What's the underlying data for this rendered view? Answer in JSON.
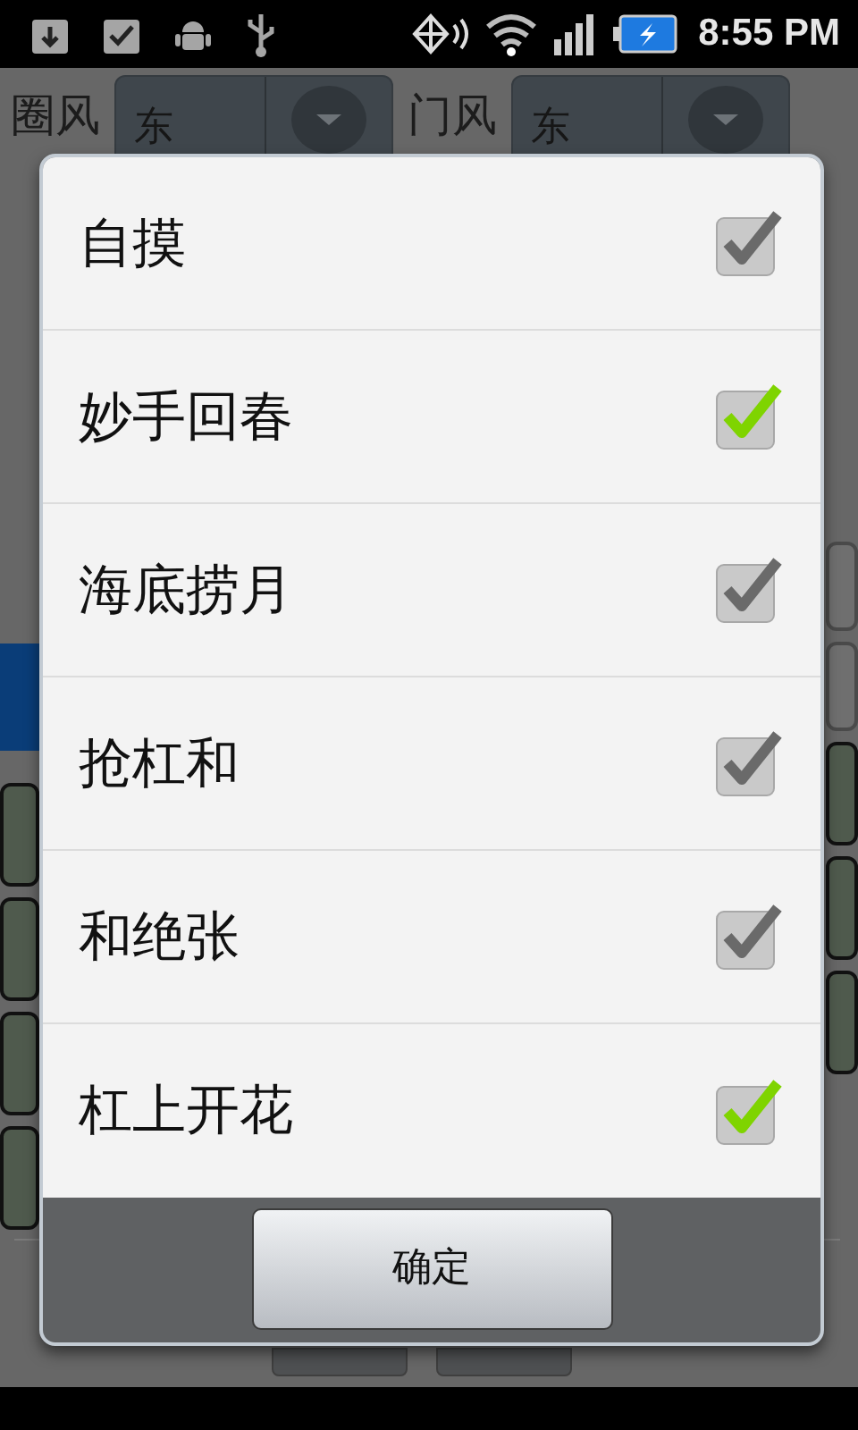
{
  "status_bar": {
    "time": "8:55 PM"
  },
  "background": {
    "fields": [
      {
        "label": "圈风",
        "value": "东"
      },
      {
        "label": "门风",
        "value": "东"
      }
    ]
  },
  "dialog": {
    "items": [
      {
        "label": "自摸",
        "checked": false
      },
      {
        "label": "妙手回春",
        "checked": true
      },
      {
        "label": "海底捞月",
        "checked": false
      },
      {
        "label": "抢杠和",
        "checked": false
      },
      {
        "label": "和绝张",
        "checked": false
      },
      {
        "label": "杠上开花",
        "checked": true
      }
    ],
    "buttons": [
      {
        "label": "确定"
      }
    ]
  }
}
